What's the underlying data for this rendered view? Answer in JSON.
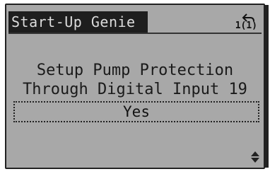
{
  "screen": {
    "title": "Start-Up Genie",
    "nav_code": "1(1)",
    "message_line1": "Setup Pump Protection",
    "message_line2": "Through Digital Input 19",
    "selected_value": "Yes",
    "icons": {
      "back": "back-arrow-icon",
      "scroll": "up-down-arrow-icon"
    }
  }
}
